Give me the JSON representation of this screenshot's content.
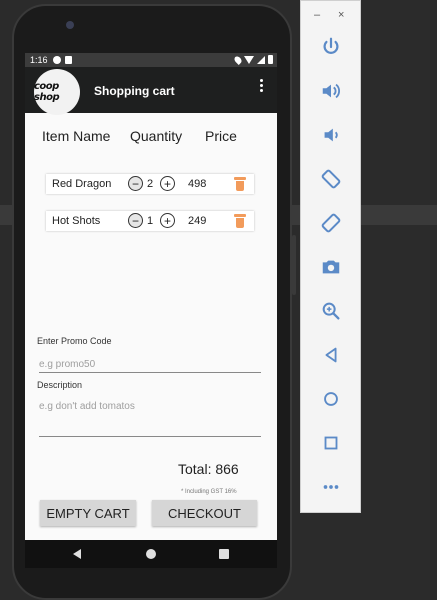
{
  "status_bar": {
    "time": "1:16"
  },
  "app_bar": {
    "logo_text": "coop shop",
    "title": "Shopping cart"
  },
  "columns": {
    "name": "Item Name",
    "quantity": "Quantity",
    "price": "Price"
  },
  "items": [
    {
      "name": "Red Dragon",
      "quantity": "2",
      "price": "498",
      "minus": "−",
      "plus": "+"
    },
    {
      "name": "Hot Shots",
      "quantity": "1",
      "price": "249",
      "minus": "−",
      "plus": "+"
    }
  ],
  "promo": {
    "label": "Enter Promo Code",
    "placeholder": "e.g promo50"
  },
  "description": {
    "label": "Description",
    "placeholder": "e.g don't add tomatos"
  },
  "total": {
    "text": "Total: 866",
    "note": "* Including GST 16%"
  },
  "buttons": {
    "empty": "EMPTY CART",
    "checkout": "CHECKOUT"
  },
  "emulator": {
    "minimize": "–",
    "close": "×"
  },
  "colors": {
    "trash": "#f29b5b",
    "app_bar": "#1e1f1f",
    "toolbar_icon": "#5b8ac7"
  }
}
